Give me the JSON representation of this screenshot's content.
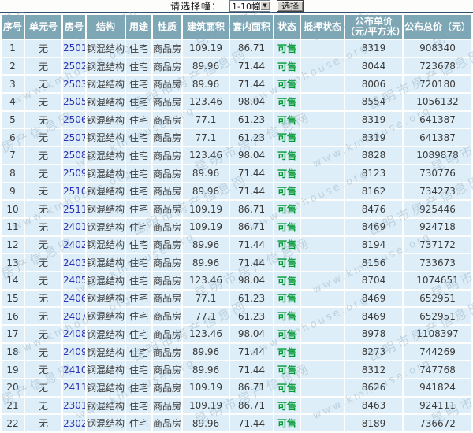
{
  "controls": {
    "label": "请选择幢：",
    "select_value": "1-10幢",
    "button_label": "选择"
  },
  "watermark": {
    "site_name": "昆明市房产信息网",
    "site_url": "www.kmhouse.org"
  },
  "colors": {
    "header_bg": "#7ea7b6",
    "row_bg": "#ddeef8",
    "table_top_border": "#31506e",
    "status_green": "#009933",
    "room_link_blue": "#2d31b5"
  },
  "table": {
    "headers": [
      "序号",
      "单元号",
      "房号",
      "结构",
      "用途",
      "性质",
      "建筑面积",
      "套内面积",
      "状态",
      "抵押状态",
      "公布单价（元/平方米）",
      "公布总价（元）"
    ],
    "rows": [
      {
        "seq": "1",
        "unit": "无",
        "room": "2501",
        "structure": "钢混结构",
        "use": "住宅",
        "nature": "商品房",
        "build_area": "109.19",
        "inner_area": "86.71",
        "status": "可售",
        "mortgage": "",
        "unit_price": "8319",
        "total_price": "908340"
      },
      {
        "seq": "2",
        "unit": "无",
        "room": "2502",
        "structure": "钢混结构",
        "use": "住宅",
        "nature": "商品房",
        "build_area": "89.96",
        "inner_area": "71.44",
        "status": "可售",
        "mortgage": "",
        "unit_price": "8044",
        "total_price": "723678"
      },
      {
        "seq": "3",
        "unit": "无",
        "room": "2503",
        "structure": "钢混结构",
        "use": "住宅",
        "nature": "商品房",
        "build_area": "89.96",
        "inner_area": "71.44",
        "status": "可售",
        "mortgage": "",
        "unit_price": "8006",
        "total_price": "720180"
      },
      {
        "seq": "4",
        "unit": "无",
        "room": "2505",
        "structure": "钢混结构",
        "use": "住宅",
        "nature": "商品房",
        "build_area": "123.46",
        "inner_area": "98.04",
        "status": "可售",
        "mortgage": "",
        "unit_price": "8554",
        "total_price": "1056132"
      },
      {
        "seq": "5",
        "unit": "无",
        "room": "2506",
        "structure": "钢混结构",
        "use": "住宅",
        "nature": "商品房",
        "build_area": "77.1",
        "inner_area": "61.23",
        "status": "可售",
        "mortgage": "",
        "unit_price": "8319",
        "total_price": "641387"
      },
      {
        "seq": "6",
        "unit": "无",
        "room": "2507",
        "structure": "钢混结构",
        "use": "住宅",
        "nature": "商品房",
        "build_area": "77.1",
        "inner_area": "61.23",
        "status": "可售",
        "mortgage": "",
        "unit_price": "8319",
        "total_price": "641387"
      },
      {
        "seq": "7",
        "unit": "无",
        "room": "2508",
        "structure": "钢混结构",
        "use": "住宅",
        "nature": "商品房",
        "build_area": "123.46",
        "inner_area": "98.04",
        "status": "可售",
        "mortgage": "",
        "unit_price": "8828",
        "total_price": "1089878"
      },
      {
        "seq": "8",
        "unit": "无",
        "room": "2509",
        "structure": "钢混结构",
        "use": "住宅",
        "nature": "商品房",
        "build_area": "89.96",
        "inner_area": "71.44",
        "status": "可售",
        "mortgage": "",
        "unit_price": "8123",
        "total_price": "730776"
      },
      {
        "seq": "9",
        "unit": "无",
        "room": "2510",
        "structure": "钢混结构",
        "use": "住宅",
        "nature": "商品房",
        "build_area": "89.96",
        "inner_area": "71.44",
        "status": "可售",
        "mortgage": "",
        "unit_price": "8162",
        "total_price": "734273"
      },
      {
        "seq": "10",
        "unit": "无",
        "room": "2511",
        "structure": "钢混结构",
        "use": "住宅",
        "nature": "商品房",
        "build_area": "109.19",
        "inner_area": "86.71",
        "status": "可售",
        "mortgage": "",
        "unit_price": "8476",
        "total_price": "925446"
      },
      {
        "seq": "11",
        "unit": "无",
        "room": "2401",
        "structure": "钢混结构",
        "use": "住宅",
        "nature": "商品房",
        "build_area": "109.19",
        "inner_area": "86.71",
        "status": "可售",
        "mortgage": "",
        "unit_price": "8469",
        "total_price": "924718"
      },
      {
        "seq": "12",
        "unit": "无",
        "room": "2402",
        "structure": "钢混结构",
        "use": "住宅",
        "nature": "商品房",
        "build_area": "89.96",
        "inner_area": "71.44",
        "status": "可售",
        "mortgage": "",
        "unit_price": "8194",
        "total_price": "737172"
      },
      {
        "seq": "13",
        "unit": "无",
        "room": "2403",
        "structure": "钢混结构",
        "use": "住宅",
        "nature": "商品房",
        "build_area": "89.96",
        "inner_area": "71.44",
        "status": "可售",
        "mortgage": "",
        "unit_price": "8156",
        "total_price": "733673"
      },
      {
        "seq": "14",
        "unit": "无",
        "room": "2405",
        "structure": "钢混结构",
        "use": "住宅",
        "nature": "商品房",
        "build_area": "123.46",
        "inner_area": "98.04",
        "status": "可售",
        "mortgage": "",
        "unit_price": "8704",
        "total_price": "1074651"
      },
      {
        "seq": "15",
        "unit": "无",
        "room": "2406",
        "structure": "钢混结构",
        "use": "住宅",
        "nature": "商品房",
        "build_area": "77.1",
        "inner_area": "61.23",
        "status": "可售",
        "mortgage": "",
        "unit_price": "8469",
        "total_price": "652951"
      },
      {
        "seq": "16",
        "unit": "无",
        "room": "2407",
        "structure": "钢混结构",
        "use": "住宅",
        "nature": "商品房",
        "build_area": "77.1",
        "inner_area": "61.23",
        "status": "可售",
        "mortgage": "",
        "unit_price": "8469",
        "total_price": "652951"
      },
      {
        "seq": "17",
        "unit": "无",
        "room": "2408",
        "structure": "钢混结构",
        "use": "住宅",
        "nature": "商品房",
        "build_area": "123.46",
        "inner_area": "98.04",
        "status": "可售",
        "mortgage": "",
        "unit_price": "8978",
        "total_price": "1108397"
      },
      {
        "seq": "18",
        "unit": "无",
        "room": "2409",
        "structure": "钢混结构",
        "use": "住宅",
        "nature": "商品房",
        "build_area": "89.96",
        "inner_area": "71.44",
        "status": "可售",
        "mortgage": "",
        "unit_price": "8273",
        "total_price": "744269"
      },
      {
        "seq": "19",
        "unit": "无",
        "room": "2410",
        "structure": "钢混结构",
        "use": "住宅",
        "nature": "商品房",
        "build_area": "89.96",
        "inner_area": "71.44",
        "status": "可售",
        "mortgage": "",
        "unit_price": "8312",
        "total_price": "747768"
      },
      {
        "seq": "20",
        "unit": "无",
        "room": "2411",
        "structure": "钢混结构",
        "use": "住宅",
        "nature": "商品房",
        "build_area": "109.19",
        "inner_area": "86.71",
        "status": "可售",
        "mortgage": "",
        "unit_price": "8626",
        "total_price": "941824"
      },
      {
        "seq": "21",
        "unit": "无",
        "room": "2301",
        "structure": "钢混结构",
        "use": "住宅",
        "nature": "商品房",
        "build_area": "109.19",
        "inner_area": "86.71",
        "status": "可售",
        "mortgage": "",
        "unit_price": "8463",
        "total_price": "924111"
      },
      {
        "seq": "22",
        "unit": "无",
        "room": "2302",
        "structure": "钢混结构",
        "use": "住宅",
        "nature": "商品房",
        "build_area": "89.96",
        "inner_area": "71.44",
        "status": "可售",
        "mortgage": "",
        "unit_price": "8189",
        "total_price": "736672"
      }
    ]
  }
}
